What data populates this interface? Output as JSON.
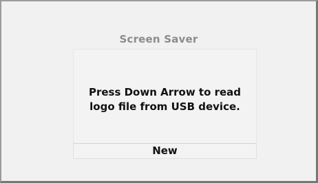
{
  "screen": {
    "title": "Screen Saver",
    "message_line1": "Press Down Arrow to read",
    "message_line2": "logo file from USB device.",
    "button_label": "New"
  }
}
